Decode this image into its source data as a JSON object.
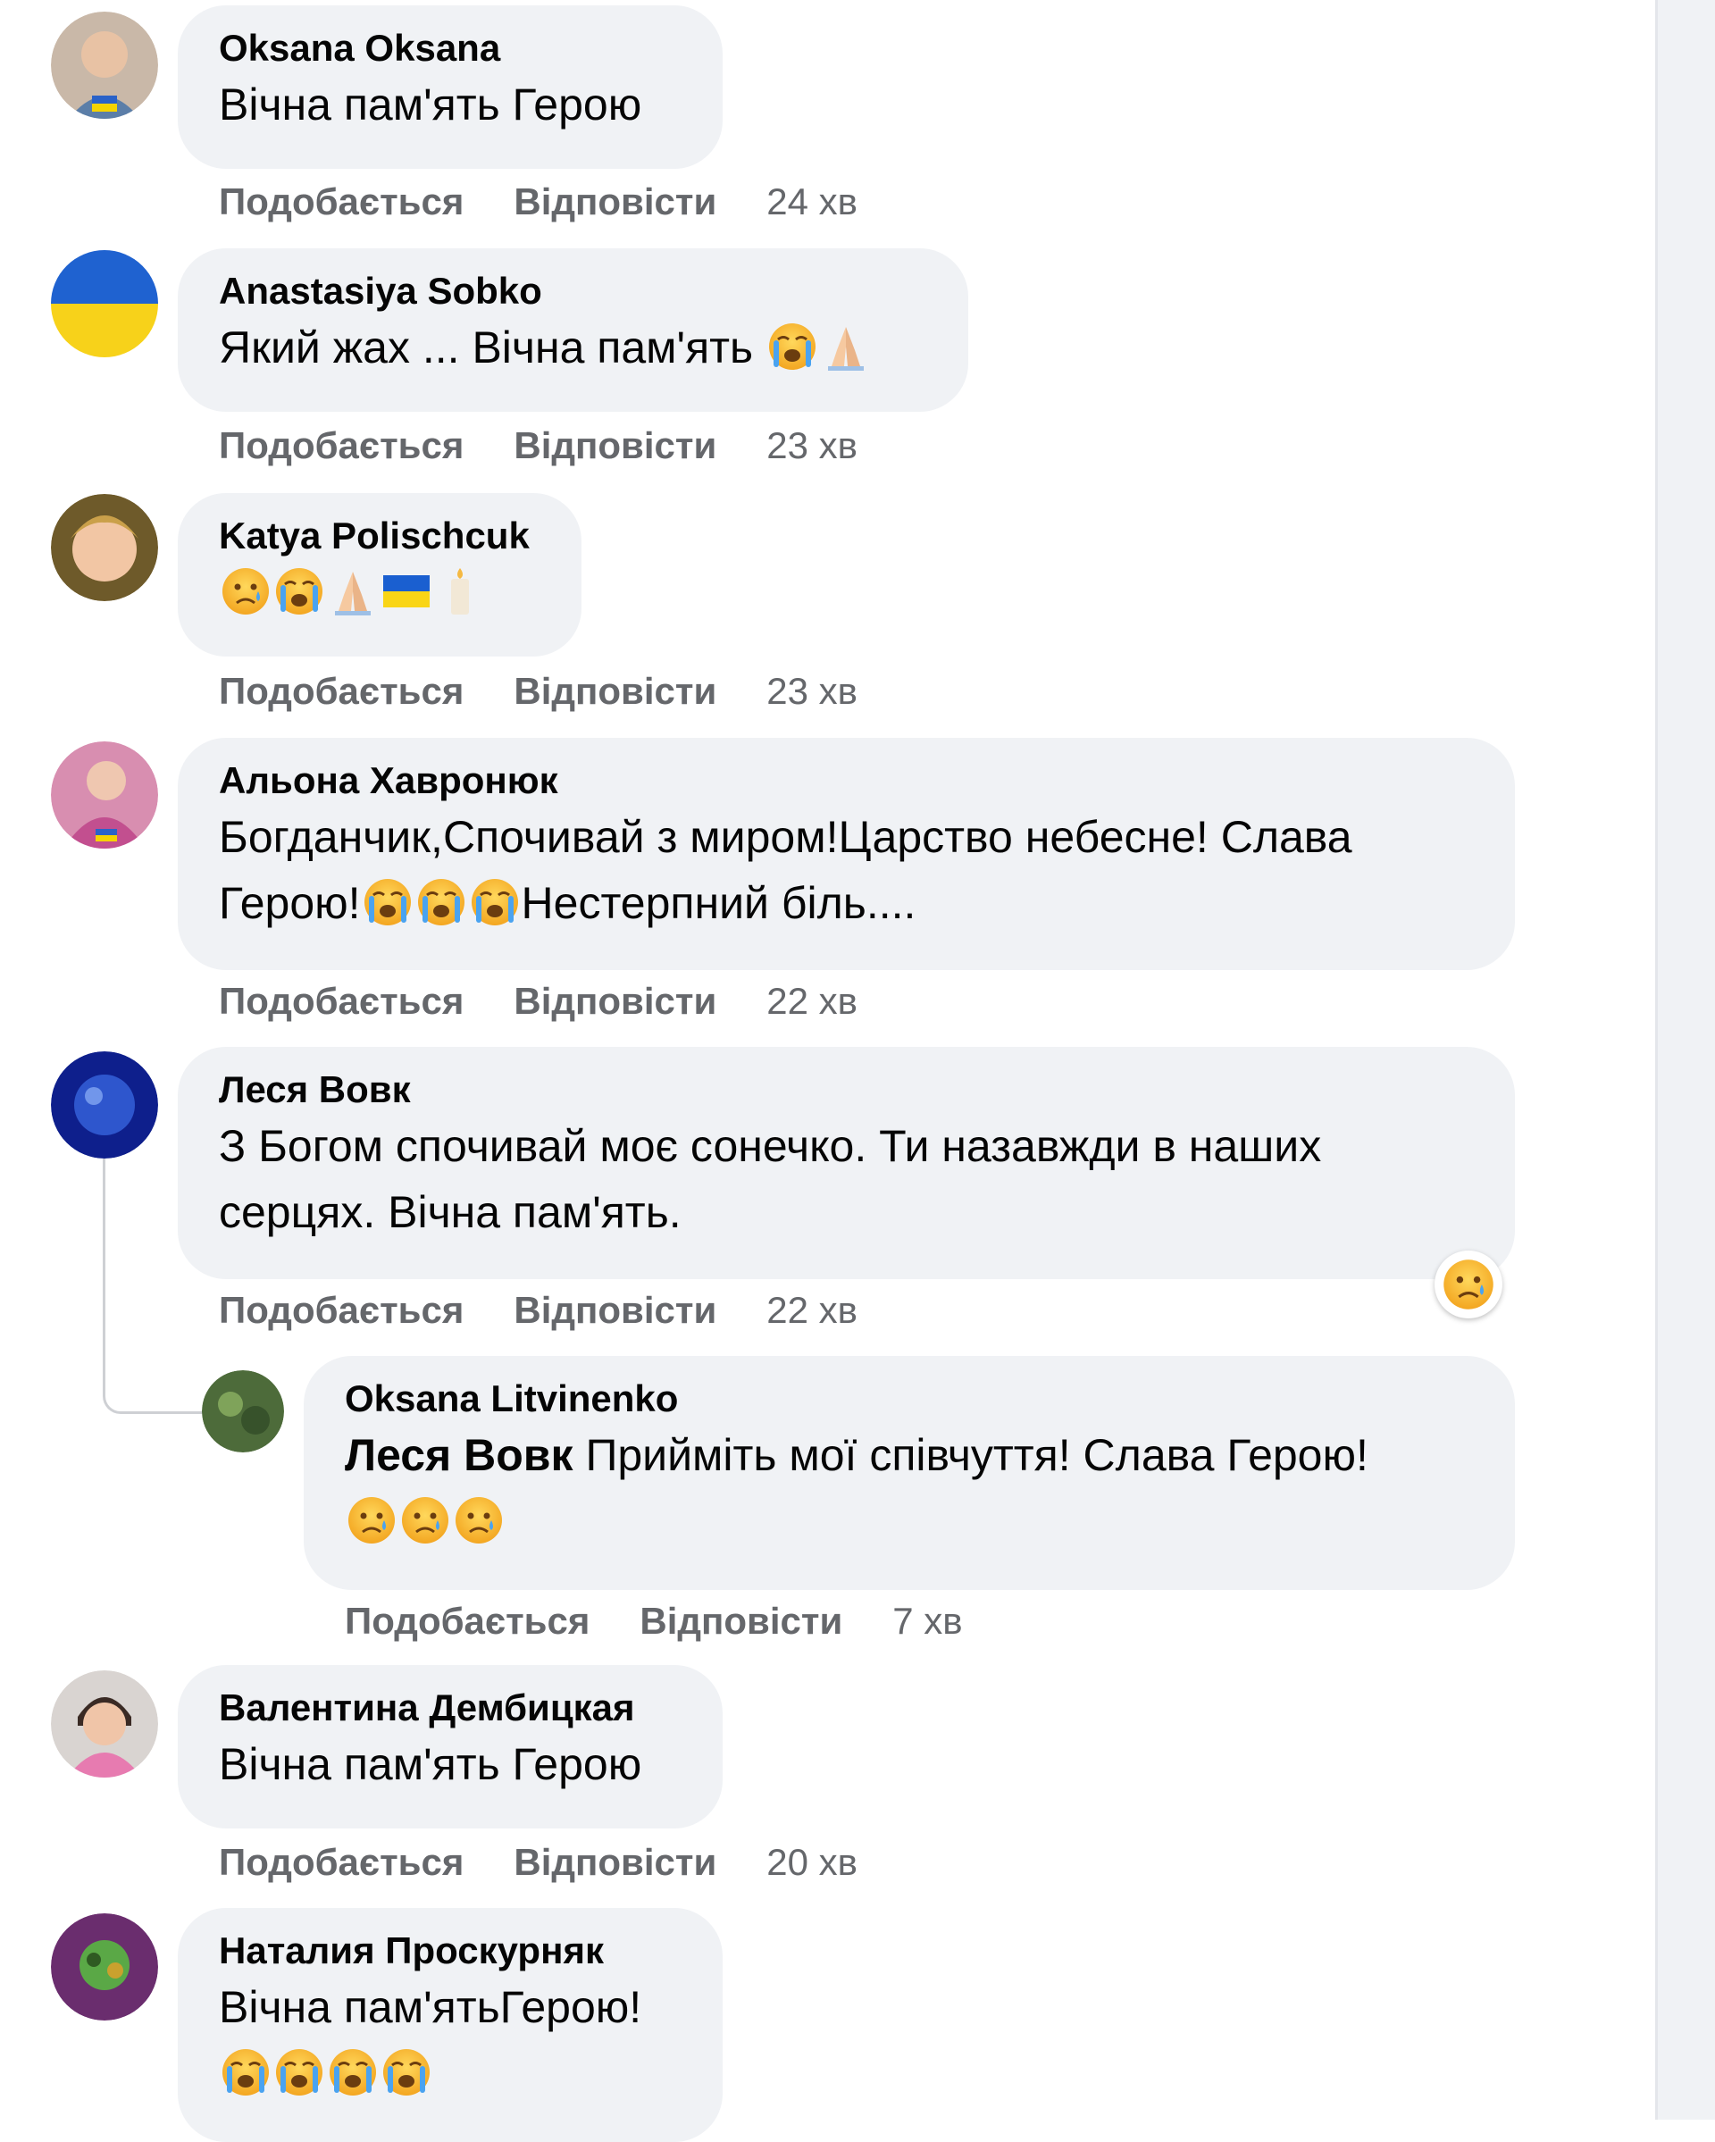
{
  "actions": {
    "like": "Подобається",
    "reply": "Відповісти"
  },
  "comments": [
    {
      "author": "Oksana Oksana",
      "text": "Вічна пам'ять Герою",
      "time": "24 хв"
    },
    {
      "author": "Anastasiya Sobko",
      "text": "Який жах ... Вічна пам'ять",
      "emojis": [
        "crying-face",
        "folded-hands"
      ],
      "time": "23 хв"
    },
    {
      "author": "Katya Polischcuk",
      "text": "",
      "emojis": [
        "sad-face",
        "crying-face",
        "folded-hands",
        "ukraine-flag",
        "candle"
      ],
      "time": "23 хв"
    },
    {
      "author": "Альона Хавронюк",
      "text_line1": "Богданчик,Спочивай з миром!Царство небесне! Слава",
      "text_line2_start": "Герою!",
      "text_line2_end": "Нестерпний біль....",
      "emojis": [
        "crying-face",
        "crying-face",
        "crying-face"
      ],
      "time": "22 хв"
    },
    {
      "author": "Леся Вовк",
      "text_line1": "З Богом спочивай моє сонечко. Ти назавжди в наших",
      "text_line2": "серцях. Вічна пам'ять.",
      "reaction": "sad-reaction",
      "time": "22 хв",
      "reply": {
        "author": "Oksana Litvinenko",
        "mention": "Леся Вовк",
        "text": "Прийміть мої співчуття! Слава Герою!",
        "emojis": [
          "sad-face",
          "sad-face",
          "sad-face"
        ],
        "time": "7 хв"
      }
    },
    {
      "author": "Валентина Дембицкая",
      "text": "Вічна пам'ять Герою",
      "time": "20 хв"
    },
    {
      "author": "Наталия Проскурняк",
      "text": "Вічна пам'ятьГерою!",
      "emojis": [
        "crying-face",
        "crying-face",
        "crying-face",
        "crying-face"
      ]
    }
  ],
  "colors": {
    "bubble": "#f0f2f5",
    "meta": "#65676b",
    "text": "#050505"
  }
}
